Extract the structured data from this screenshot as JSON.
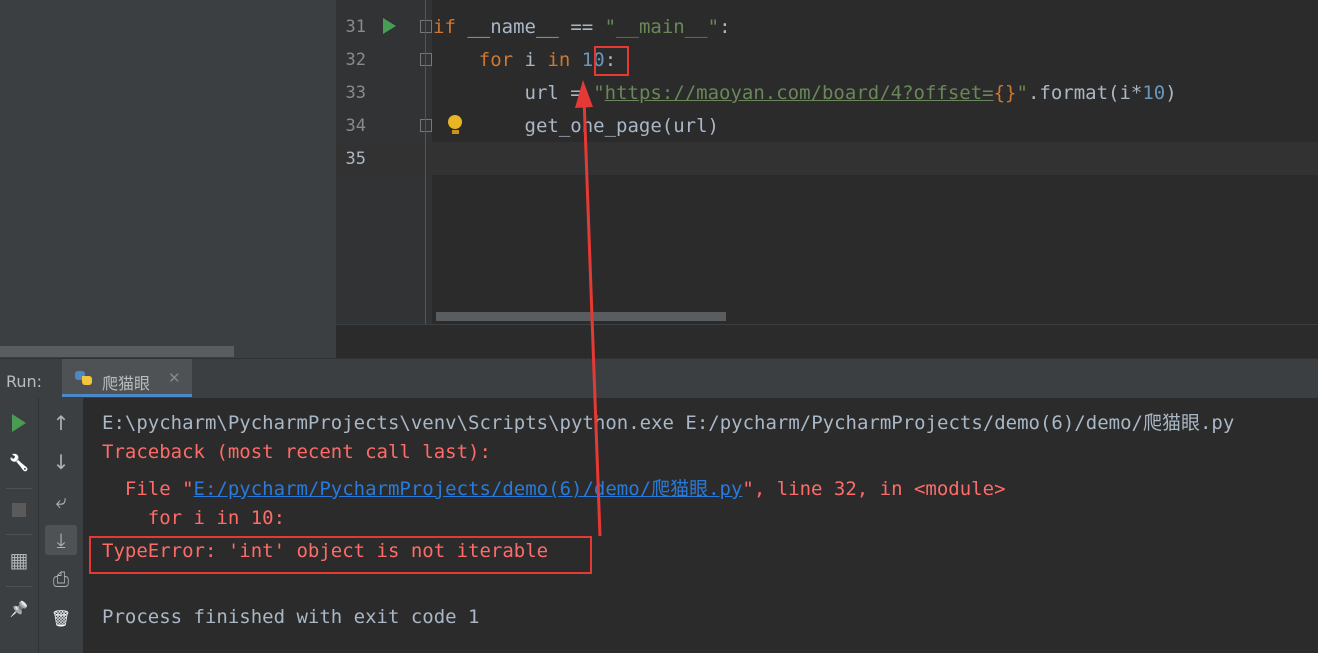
{
  "editor": {
    "lines": [
      {
        "num": "31"
      },
      {
        "num": "32"
      },
      {
        "num": "33"
      },
      {
        "num": "34"
      },
      {
        "num": "35"
      }
    ],
    "tokens": {
      "if_kw": "if",
      "name_var": "__name__",
      "eq_op": "==",
      "main_str_q1": "\"",
      "main_str": "__main__",
      "main_str_q2": "\"",
      "colon1": ":",
      "for_kw": "for",
      "i_var": "i",
      "in_kw": "in",
      "ten_num": "10",
      "colon2": ":",
      "url_var": "url",
      "assign_op": "=",
      "quote_open": "\"",
      "url_text": "https://maoyan.com/board/4?offset=",
      "braces": "{}",
      "quote_close": "\"",
      "format_call": ".format(i*",
      "ten_num2": "10",
      "close_paren": ")",
      "get_call": "get_one_page(url)"
    }
  },
  "run": {
    "label": "Run:",
    "tab_title": "爬猫眼",
    "tab_close": "✕",
    "console": {
      "cmd": "E:\\pycharm\\PycharmProjects\\venv\\Scripts\\python.exe E:/pycharm/PycharmProjects/demo(6)/demo/爬猫眼.py",
      "traceback": "Traceback (most recent call last):",
      "file_prefix": "  File \"",
      "file_link": "E:/pycharm/PycharmProjects/demo(6)/demo/爬猫眼.py",
      "file_suffix": "\", line 32, in <module>",
      "code_line": "    for i in 10:",
      "error": "TypeError: 'int' object is not iterable",
      "finished": "Process finished with exit code 1"
    }
  },
  "icons": {
    "up": "↑",
    "down": "↓",
    "wrap": "⤶",
    "scroll_end": "⤓",
    "print": "⎙",
    "trash": "🗑",
    "wrench": "🔧",
    "layout": "▦",
    "pin": "📌"
  },
  "colors": {
    "keyword": "#cc7832",
    "string": "#6a8759",
    "number": "#6897bb",
    "error": "#ff6b68",
    "link": "#287bde",
    "annotation": "#e53935"
  }
}
